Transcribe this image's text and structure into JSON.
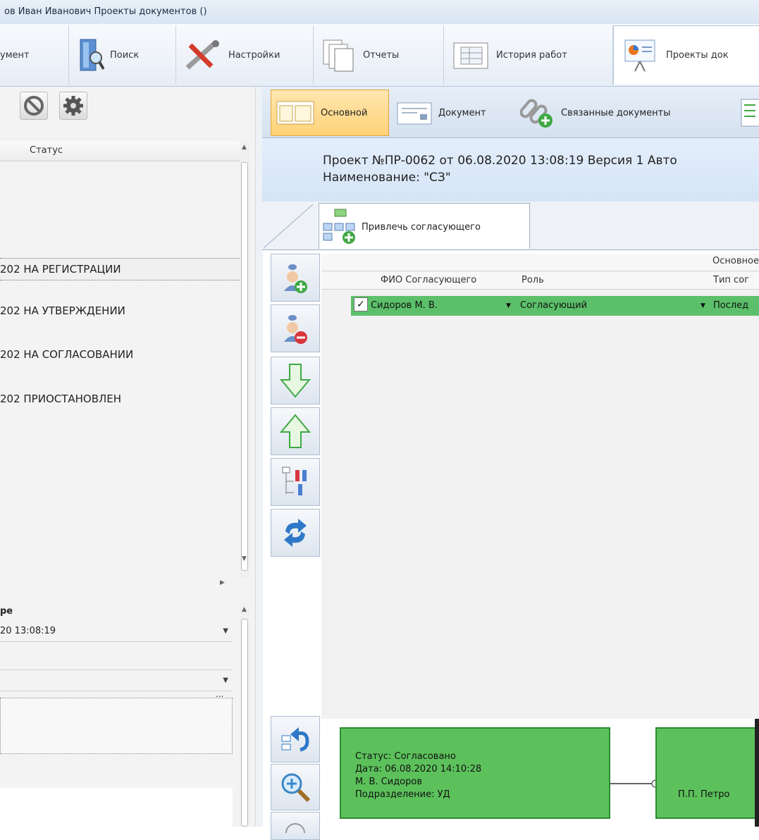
{
  "title": "ов Иван Иванович  Проекты документов ()",
  "ribbon": {
    "tabs": [
      {
        "label": "умент",
        "icon": "document-icon"
      },
      {
        "label": "Поиск",
        "icon": "search-icon"
      },
      {
        "label": "Настройки",
        "icon": "tools-icon"
      },
      {
        "label": "Отчеты",
        "icon": "reports-icon"
      },
      {
        "label": "История работ",
        "icon": "history-icon"
      },
      {
        "label": "Проекты док",
        "icon": "projects-icon"
      }
    ]
  },
  "left_panel": {
    "buttons": [
      "cancel-icon",
      "gear-icon"
    ],
    "grid": {
      "header": "Статус",
      "rows": [
        "202 НА РЕГИСТРАЦИИ",
        "202 НА УТВЕРЖДЕНИИ",
        "202 НА СОГЛАСОВАНИИ",
        "202 ПРИОСТАНОВЛЕН"
      ]
    },
    "props": {
      "title": "ре",
      "date": "20 13:08:19",
      "more": "..."
    }
  },
  "doc_tabs": [
    {
      "label": "Основной",
      "active": true
    },
    {
      "label": "Документ",
      "active": false
    },
    {
      "label": "Связанные документы",
      "active": false
    }
  ],
  "project": {
    "line1": "Проект №ПР-0062 от 06.08.2020 13:08:19 Версия 1 Авто",
    "line2": "Наименование: \"СЗ\""
  },
  "subtab": {
    "label": "Привлечь согласующего"
  },
  "grid": {
    "band": "Основное",
    "columns": [
      "ФИО Согласующего",
      "Роль",
      "Тип сог"
    ],
    "row": {
      "checked": true,
      "fio": "Сидоров М. В.",
      "role": "Согласующий",
      "type": "Послед"
    }
  },
  "toolbar": [
    "add-approver-icon",
    "remove-approver-icon",
    "arrow-down-icon",
    "arrow-up-icon",
    "tree-icon",
    "refresh-icon"
  ],
  "toolbar2": [
    "undo-icon",
    "zoom-in-icon"
  ],
  "workflow": {
    "node1": {
      "status": "Статус: Согласовано",
      "date": "Дата: 06.08.2020 14:10:28",
      "person": "М. В. Сидоров",
      "dept": "Подразделение: УД"
    },
    "node2": {
      "person": "П.П. Петро"
    }
  },
  "colors": {
    "accent": "#5cc06a",
    "active_tab": "#ffd277",
    "header_bg": "#d5e4f6"
  }
}
